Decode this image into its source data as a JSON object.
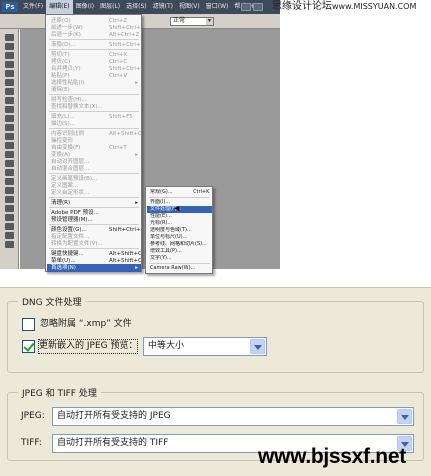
{
  "photoshop": {
    "logo": "Ps",
    "menu": [
      "文件(F)",
      "编辑(E)",
      "图像(I)",
      "图层(L)",
      "选择(S)",
      "滤镜(T)",
      "视图(V)",
      "窗口(W)",
      "帮助(H)"
    ],
    "active_menu_index": 1,
    "watermark": "思缘设计论坛",
    "watermark_url": "www.MISSYUAN.COM",
    "options_select": "正常",
    "edit_menu": [
      {
        "label": "还原(O)",
        "shortcut": "Ctrl+Z",
        "enabled": false
      },
      {
        "label": "前进一步(W)",
        "shortcut": "Shift+Ctrl+Z",
        "enabled": false
      },
      {
        "label": "后退一步(K)",
        "shortcut": "Alt+Ctrl+Z",
        "enabled": false
      },
      {
        "sep": true
      },
      {
        "label": "渐隐(D)...",
        "shortcut": "Shift+Ctrl+F",
        "enabled": false
      },
      {
        "sep": true
      },
      {
        "label": "剪切(T)",
        "shortcut": "Ctrl+X",
        "enabled": false
      },
      {
        "label": "拷贝(C)",
        "shortcut": "Ctrl+C",
        "enabled": false
      },
      {
        "label": "合并拷贝(Y)",
        "shortcut": "Shift+Ctrl+C",
        "enabled": false
      },
      {
        "label": "粘贴(P)",
        "shortcut": "Ctrl+V",
        "enabled": false
      },
      {
        "label": "选择性粘贴(I)",
        "shortcut": "",
        "enabled": false,
        "arrow": true
      },
      {
        "label": "清除(E)",
        "shortcut": "",
        "enabled": false
      },
      {
        "sep": true
      },
      {
        "label": "拼写检查(H)...",
        "shortcut": "",
        "enabled": false
      },
      {
        "label": "查找和替换文本(X)...",
        "shortcut": "",
        "enabled": false
      },
      {
        "sep": true
      },
      {
        "label": "填充(L)...",
        "shortcut": "Shift+F5",
        "enabled": false
      },
      {
        "label": "描边(S)...",
        "shortcut": "",
        "enabled": false
      },
      {
        "sep": true
      },
      {
        "label": "内容识别比例",
        "shortcut": "Alt+Shift+Ctrl+C",
        "enabled": false
      },
      {
        "label": "操控变形",
        "shortcut": "",
        "enabled": false
      },
      {
        "label": "自由变换(F)",
        "shortcut": "Ctrl+T",
        "enabled": false
      },
      {
        "label": "变换(A)",
        "shortcut": "",
        "enabled": false,
        "arrow": true
      },
      {
        "label": "自动对齐图层...",
        "shortcut": "",
        "enabled": false
      },
      {
        "label": "自动混合图层...",
        "shortcut": "",
        "enabled": false
      },
      {
        "sep": true
      },
      {
        "label": "定义画笔预设(B)...",
        "shortcut": "",
        "enabled": false
      },
      {
        "label": "定义图案...",
        "shortcut": "",
        "enabled": false
      },
      {
        "label": "定义自定形状...",
        "shortcut": "",
        "enabled": false
      },
      {
        "sep": true
      },
      {
        "label": "清理(R)",
        "shortcut": "",
        "enabled": true,
        "arrow": true
      },
      {
        "sep": true
      },
      {
        "label": "Adobe PDF 预设...",
        "shortcut": "",
        "enabled": true
      },
      {
        "label": "预设管理器(M)...",
        "shortcut": "",
        "enabled": true
      },
      {
        "sep": true
      },
      {
        "label": "颜色设置(G)...",
        "shortcut": "Shift+Ctrl+K",
        "enabled": true
      },
      {
        "label": "指定配置文件...",
        "shortcut": "",
        "enabled": false
      },
      {
        "label": "转换为配置文件(V)...",
        "shortcut": "",
        "enabled": false
      },
      {
        "sep": true
      },
      {
        "label": "键盘快捷键...",
        "shortcut": "Alt+Shift+Ctrl+K",
        "enabled": true
      },
      {
        "label": "菜单(U)...",
        "shortcut": "Alt+Shift+Ctrl+M",
        "enabled": true
      },
      {
        "label": "首选项(N)",
        "shortcut": "",
        "enabled": true,
        "arrow": true,
        "selected": true
      }
    ],
    "prefs_submenu": [
      {
        "label": "常规(G)...",
        "shortcut": "Ctrl+K"
      },
      {
        "sep": true
      },
      {
        "label": "界面(I)..."
      },
      {
        "label": "文件处理(F)...",
        "selected": true
      },
      {
        "label": "性能(E)..."
      },
      {
        "label": "光标(R)..."
      },
      {
        "label": "透明度与色域(T)..."
      },
      {
        "label": "单位与标尺(U)..."
      },
      {
        "label": "参考线、网格和切片(S)..."
      },
      {
        "label": "增效工具(P)..."
      },
      {
        "label": "文字(Y)..."
      },
      {
        "sep": true
      },
      {
        "label": "Camera Raw(W)..."
      }
    ]
  },
  "dng": {
    "legend": "DNG 文件处理",
    "ignore_xmp": {
      "label": "忽略附属 “.xmp” 文件",
      "checked": false
    },
    "update_preview": {
      "label": "更新嵌入的 JPEG 预览：",
      "checked": true
    },
    "preview_size": "中等大小"
  },
  "jpeg_tiff": {
    "legend": "JPEG 和 TIFF 处理",
    "jpeg_label": "JPEG:",
    "jpeg_value": "自动打开所有受支持的 JPEG",
    "tiff_label": "TIFF:",
    "tiff_value": "自动打开所有受支持的 TIFF"
  },
  "site_watermark": "www.bjssxf.net"
}
